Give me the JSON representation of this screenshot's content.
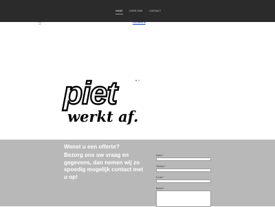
{
  "nav": {
    "items": [
      {
        "label": "HOME",
        "active": true
      },
      {
        "label": "OVER ONS",
        "active": false
      },
      {
        "label": "CONTACT",
        "active": false
      }
    ]
  },
  "top_link": "Piet werkt af",
  "logo": {
    "line1": "piet",
    "line2": "werkt af."
  },
  "contact": {
    "heading": "Wenst u een offerte?",
    "text": "Bezorg ons uw vraag en gegevens, dan nemen wij zo spoedig mogelijk contact met u op!",
    "fields": [
      {
        "label": "Naam *",
        "value": ""
      },
      {
        "label": "Telefoon *",
        "value": ""
      },
      {
        "label": "E-mail *",
        "value": ""
      },
      {
        "label": "Bericht *",
        "value": ""
      }
    ]
  },
  "colors": {
    "topbar": "#2b2b2b",
    "contact_bg": "#b8b8b8",
    "heading_text": "#ffffff",
    "link": "#1d4fbf"
  }
}
